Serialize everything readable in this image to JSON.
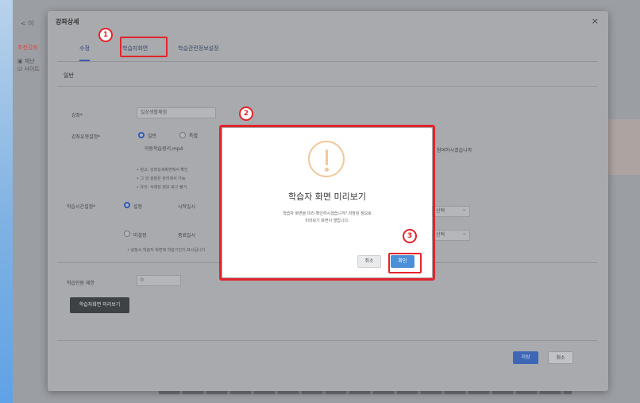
{
  "background": {
    "top_nav": "< 이",
    "side_items": [
      "추천강좌",
      "▣ 재난",
      "☑ 사이트"
    ]
  },
  "modal": {
    "title": "강좌상세",
    "close_glyph": "×",
    "tabs": [
      {
        "label": "수정"
      },
      {
        "label": "학습자화면"
      },
      {
        "label": "학습관련정보설정"
      }
    ],
    "section": "일반",
    "fields": {
      "course_label": "강좌*",
      "course_value": "일상생활체험",
      "type_label": "강좌유형설정*",
      "type_opt1": "일반",
      "type_opt2": "특별",
      "file_name": "이동학습원리.mp4",
      "notes": [
        "• 참고: 강좌상세화면에서 확인",
        "• 그 외 설정은 관리에서 가능",
        "• 유의: 삭제된 정보 복구 불가"
      ],
      "study_label": "학습시간설정*",
      "study_opt1": "설정",
      "study_sub": "시작일시",
      "study_opt2": "미설정",
      "study_sub2": "종료일시",
      "select1": "선택",
      "select2": "선택",
      "study_note": "• 설정시 학습자 화면에 학습기간이 표시됩니다",
      "limit_label": "학습인원 제한",
      "limit_value": "0",
      "dark_button": "학습자화면 미리보기",
      "side_text": "참여하시겠습니까"
    },
    "save": "저장",
    "cancel": "취소"
  },
  "badges": [
    "1",
    "2",
    "3"
  ],
  "dialog": {
    "title": "학습자 화면 미리보기",
    "message_line1": "학습자 화면을 미리 확인하시겠습니까? 저장된 정보로",
    "message_line2": "미리보기 화면이 열립니다.",
    "cancel": "취소",
    "ok": "확인"
  },
  "colors": {
    "highlight": "#e3242b",
    "primary": "#4a90d9",
    "warning": "#f1c89a"
  }
}
